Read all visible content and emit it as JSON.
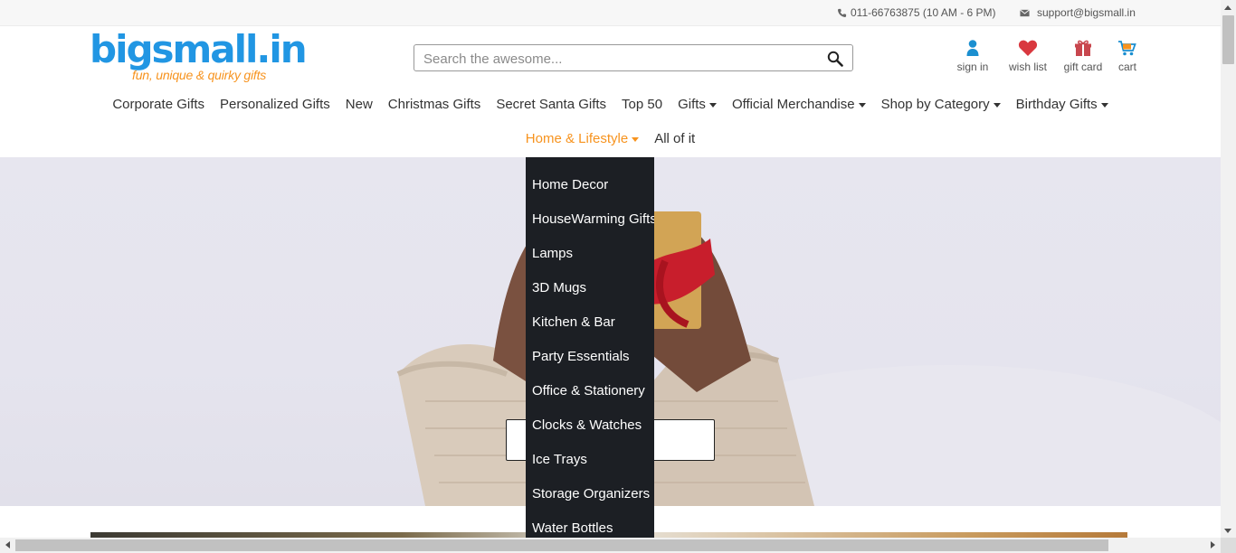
{
  "topbar": {
    "phone": "011-66763875 (10 AM - 6 PM)",
    "email": "support@bigsmall.in",
    "phone_icon": "phone-icon",
    "email_icon": "envelope-icon"
  },
  "logo": {
    "text": "bigsmall.in",
    "tagline": "fun, unique & quirky gifts"
  },
  "search": {
    "placeholder": "Search the awesome...",
    "value": "",
    "icon": "search-icon"
  },
  "header_links": {
    "signin": "sign in",
    "wishlist": "wish list",
    "giftcard": "gift card",
    "cart": "cart"
  },
  "nav": {
    "row1": [
      {
        "label": "Corporate Gifts"
      },
      {
        "label": "Personalized Gifts"
      },
      {
        "label": "New"
      },
      {
        "label": "Christmas Gifts"
      },
      {
        "label": "Secret Santa Gifts"
      },
      {
        "label": "Top 50"
      },
      {
        "label": "Gifts"
      },
      {
        "label": "Official Merchandise"
      },
      {
        "label": "Shop by Category"
      },
      {
        "label": "Birthday Gifts"
      }
    ],
    "row2": [
      {
        "label": "Home & Lifestyle"
      },
      {
        "label": "All of it"
      }
    ]
  },
  "dropdown": {
    "items": [
      "Home Decor",
      "HouseWarming Gifts",
      "Lamps",
      "3D Mugs",
      "Kitchen & Bar",
      "Party Essentials",
      "Office & Stationery",
      "Clocks & Watches",
      "Ice Trays",
      "Storage Organizers",
      "Water Bottles"
    ]
  },
  "colors": {
    "brand_blue": "#2196e3",
    "brand_orange": "#f7931e",
    "dropdown_bg": "#1c1f24",
    "wishlist_red": "#d9383f",
    "signin_blue": "#1b8fd0",
    "giftcard_red": "#c8474e"
  }
}
